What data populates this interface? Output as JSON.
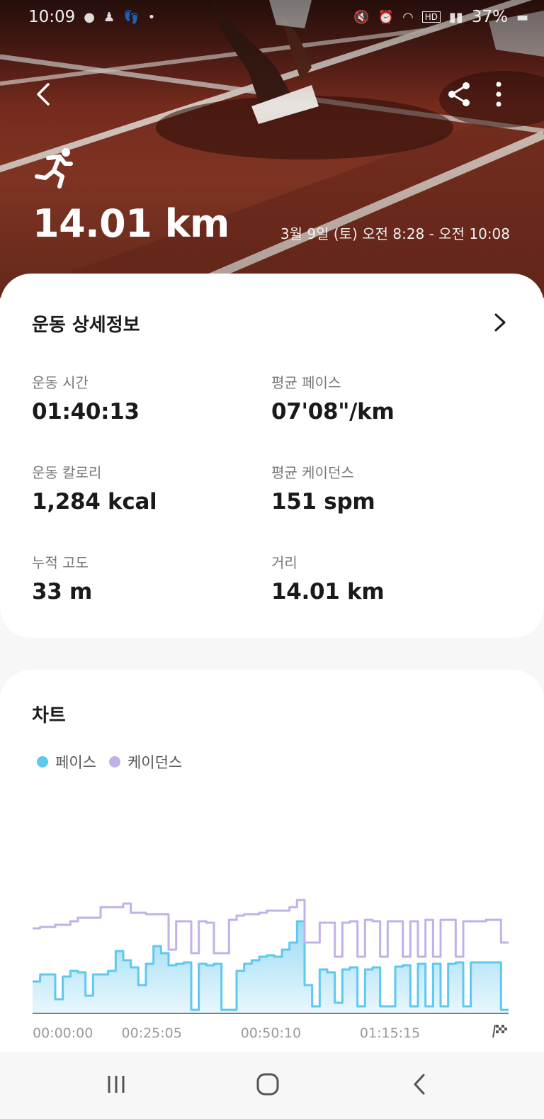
{
  "status_bar": {
    "time": "10:09",
    "battery": "37%",
    "hd_label": "HD"
  },
  "hero": {
    "distance": "14.01 km",
    "session_time": "3월 9일 (토) 오전 8:28 - 오전 10:08",
    "icons": [
      "back-icon",
      "share-icon",
      "more-icon",
      "running-icon"
    ]
  },
  "details": {
    "title": "운동 상세정보",
    "metrics": [
      {
        "label": "운동 시간",
        "value": "01:40:13"
      },
      {
        "label": "평균 페이스",
        "value": "07'08\"/km"
      },
      {
        "label": "운동 칼로리",
        "value": "1,284 kcal"
      },
      {
        "label": "평균 케이던스",
        "value": "151 spm"
      },
      {
        "label": "누적 고도",
        "value": "33 m"
      },
      {
        "label": "거리",
        "value": "14.01 km"
      }
    ]
  },
  "chart_section": {
    "title": "차트",
    "legend": [
      {
        "name": "페이스",
        "color": "#5ec8ef"
      },
      {
        "name": "케이던스",
        "color": "#c2b0ea"
      }
    ]
  },
  "chart_data": {
    "type": "area",
    "x_tick_labels": [
      "00:00:00",
      "00:25:05",
      "00:50:10",
      "01:15:15"
    ],
    "x_end_marker": "finish-flag-icon",
    "xlim_seconds": [
      0,
      6013
    ],
    "y_axis_labels_shown": false,
    "series": [
      {
        "name": "페이스",
        "kind": "area",
        "color": "#5ec8ef",
        "levels": [
          0.45,
          0.55,
          0.55,
          0.2,
          0.52,
          0.6,
          0.58,
          0.25,
          0.55,
          0.55,
          0.6,
          0.88,
          0.75,
          0.65,
          0.4,
          0.7,
          0.95,
          0.85,
          0.68,
          0.7,
          0.72,
          0.05,
          0.7,
          0.68,
          0.7,
          0.05,
          0.05,
          0.6,
          0.7,
          0.75,
          0.8,
          0.82,
          0.8,
          0.9,
          1.0,
          1.3,
          0.4,
          0.1,
          0.62,
          0.58,
          0.15,
          0.62,
          0.65,
          0.1,
          0.62,
          0.65,
          0.1,
          0.1,
          0.66,
          0.68,
          0.1,
          0.7,
          0.1,
          0.7,
          0.1,
          0.7,
          0.72,
          0.1,
          0.72,
          0.72,
          0.72,
          0.72,
          0.05
        ]
      },
      {
        "name": "케이던스",
        "kind": "line",
        "color": "#c2b0ea",
        "levels": [
          1.2,
          1.22,
          1.22,
          1.25,
          1.25,
          1.3,
          1.35,
          1.35,
          1.35,
          1.5,
          1.5,
          1.5,
          1.55,
          1.42,
          1.42,
          1.4,
          1.4,
          1.4,
          0.9,
          1.3,
          1.3,
          0.85,
          1.3,
          1.28,
          0.85,
          0.85,
          1.32,
          1.38,
          1.4,
          1.4,
          1.42,
          1.45,
          1.45,
          1.45,
          1.5,
          1.6,
          1.0,
          1.0,
          1.28,
          1.28,
          0.8,
          1.28,
          1.3,
          0.8,
          1.32,
          1.3,
          0.8,
          1.3,
          1.3,
          0.8,
          1.3,
          0.8,
          1.32,
          0.8,
          1.32,
          1.32,
          0.8,
          1.3,
          1.3,
          1.3,
          1.32,
          1.32,
          1.0
        ]
      }
    ],
    "grid": false,
    "legend_position": "top-left"
  },
  "navbar": {
    "buttons": [
      "recents-icon",
      "home-icon",
      "back-nav-icon"
    ]
  }
}
